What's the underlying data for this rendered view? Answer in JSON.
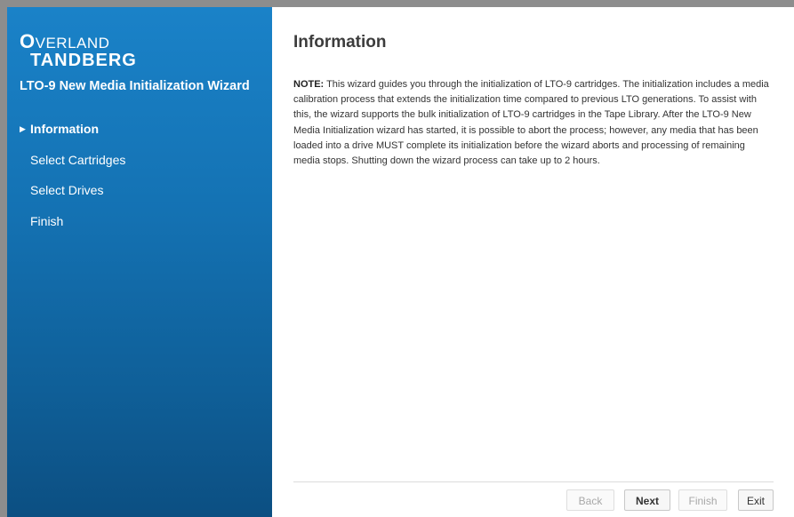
{
  "logo": {
    "line1_first": "O",
    "line1_rest": "VERLAND",
    "line2": "TANDBERG"
  },
  "sidebar": {
    "wizard_title": "LTO-9 New Media Initialization Wizard",
    "items": [
      {
        "label": "Information",
        "active": true
      },
      {
        "label": "Select Cartridges",
        "active": false
      },
      {
        "label": "Select Drives",
        "active": false
      },
      {
        "label": "Finish",
        "active": false
      }
    ]
  },
  "main": {
    "title": "Information",
    "note_label": "NOTE:",
    "note_text": " This wizard guides you through the initialization of LTO-9 cartridges. The initialization includes a media calibration process that extends the initialization time compared to previous LTO generations. To assist with this, the wizard supports the bulk initialization of LTO-9 cartridges in the Tape Library. After the LTO-9 New Media Initialization wizard has started, it is possible to abort the process; however, any media that has been loaded into a drive MUST complete its initialization before the wizard aborts and processing of remaining media stops. Shutting down the wizard process can take up to 2 hours."
  },
  "buttons": {
    "back": "Back",
    "next": "Next",
    "finish": "Finish",
    "exit": "Exit"
  },
  "colors": {
    "sidebar_top": "#1a82c8",
    "sidebar_bottom": "#0c4f82",
    "frame_border": "#8d8d8d"
  }
}
